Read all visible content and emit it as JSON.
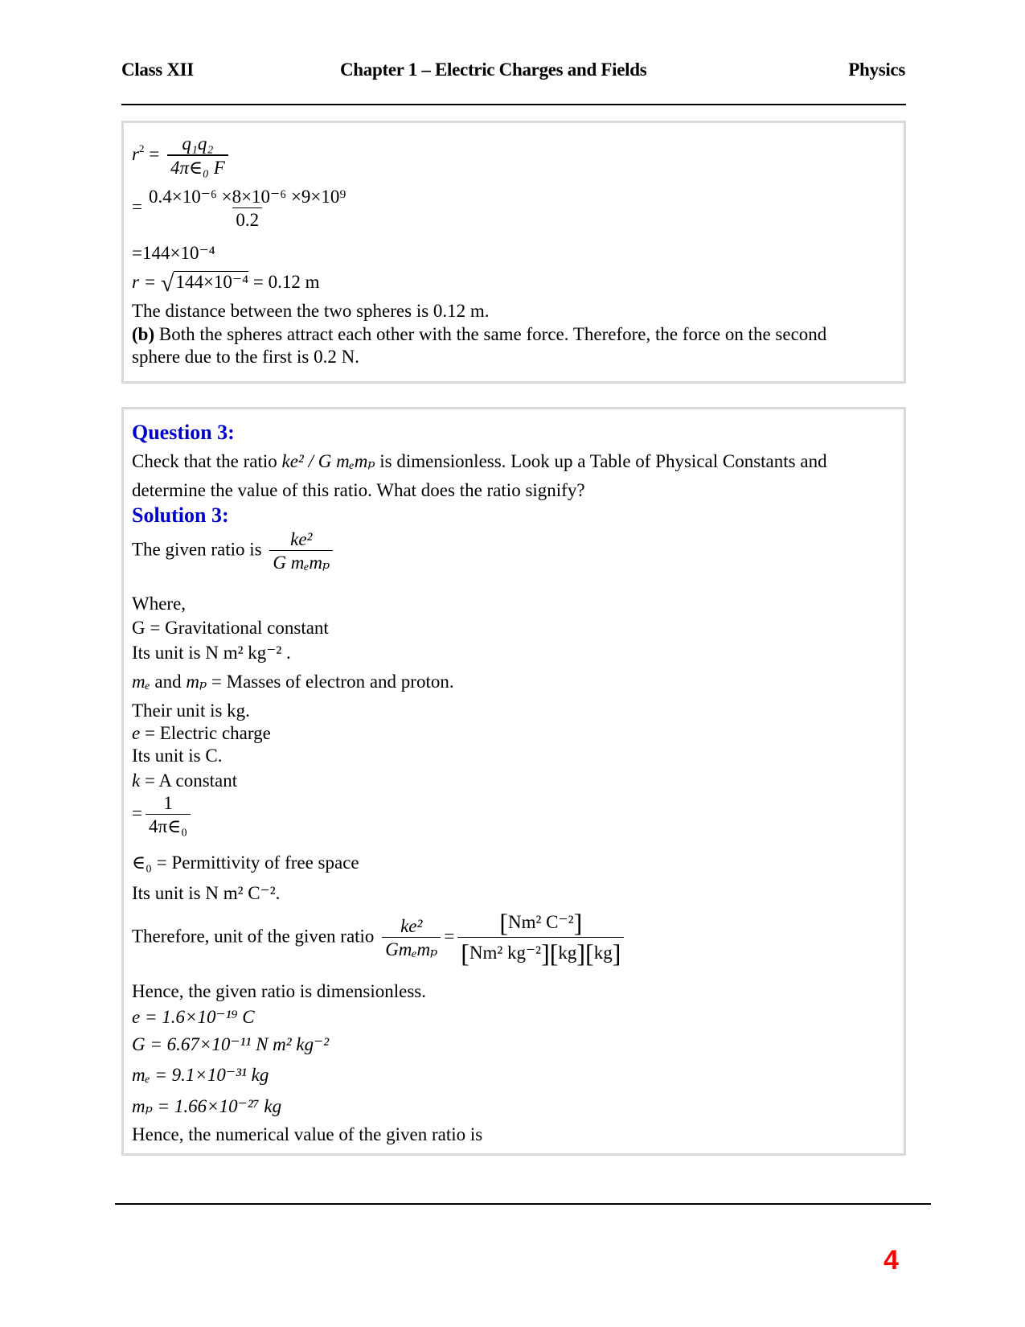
{
  "header": {
    "left": "Class XII",
    "center": "Chapter 1 – Electric Charges and Fields",
    "right": "Physics"
  },
  "box1": {
    "eq1": {
      "lhs": "r",
      "lhs_sup": "2",
      "num": "q₁q₂",
      "den": "4π∈₀ F"
    },
    "eq2": {
      "num": "0.4×10⁻⁶ ×8×10⁻⁶ ×9×10⁹",
      "den": "0.2"
    },
    "eq3": "=144×10⁻⁴",
    "eq4": {
      "lhs": "r =",
      "radicand": "144×10⁻⁴",
      "rhs": "= 0.12 m"
    },
    "line1": "The distance between the two spheres is 0.12 m.",
    "line2_bold": "(b)",
    "line2": " Both the spheres attract each other with the same force. Therefore, the force on the second",
    "line3": "sphere due to the first is 0.2 N."
  },
  "box2": {
    "question_title": "Question 3:",
    "question_line1_a": "Check that the ratio ",
    "question_ratio": "ke² / G mₑmₚ",
    "question_line1_b": " is dimensionless. Look up a Table of Physical Constants and",
    "question_line2": "determine the value of this ratio. What does the ratio signify?",
    "solution_title": "Solution 3:",
    "given_ratio_label": "The given ratio is",
    "given_ratio": {
      "num": "ke²",
      "den": "G mₑmₚ"
    },
    "where": "Where,",
    "g_def": "G = Gravitational constant",
    "g_unit": "Its unit is  N m² kg⁻² .",
    "masses_a": "mₑ",
    "masses_and": " and ",
    "masses_b": "mₚ",
    "masses_def": " = Masses of electron and proton.",
    "masses_unit": "Their unit is kg.",
    "e_sym": "e",
    "e_def": " = Electric charge",
    "e_unit": "Its unit is C.",
    "k_sym": "k",
    "k_def": " = A  constant",
    "k_frac": {
      "num": "1",
      "den": "4π∈₀"
    },
    "eps_sym": "∈₀",
    "eps_def": " = Permittivity of free space",
    "eps_unit": "Its unit is  N m² C⁻².",
    "unit_label": "Therefore, unit of the given ratio",
    "unit_lhs": {
      "num": "ke²",
      "den": "Gmₑmₚ"
    },
    "unit_rhs": {
      "num": "Nm² C⁻²",
      "den_1": "Nm² kg⁻²",
      "den_2": "kg",
      "den_3": "kg"
    },
    "dimensionless": "Hence, the given ratio is dimensionless.",
    "const_e": "e = 1.6×10⁻¹⁹ C",
    "const_g": "G = 6.67×10⁻¹¹ N m² kg⁻²",
    "const_me": "mₑ = 9.1×10⁻³¹ kg",
    "const_mp": "mₚ = 1.66×10⁻²⁷ kg",
    "numerical": "Hence, the numerical value of the given ratio is"
  },
  "footer": {
    "page_number": "4"
  }
}
